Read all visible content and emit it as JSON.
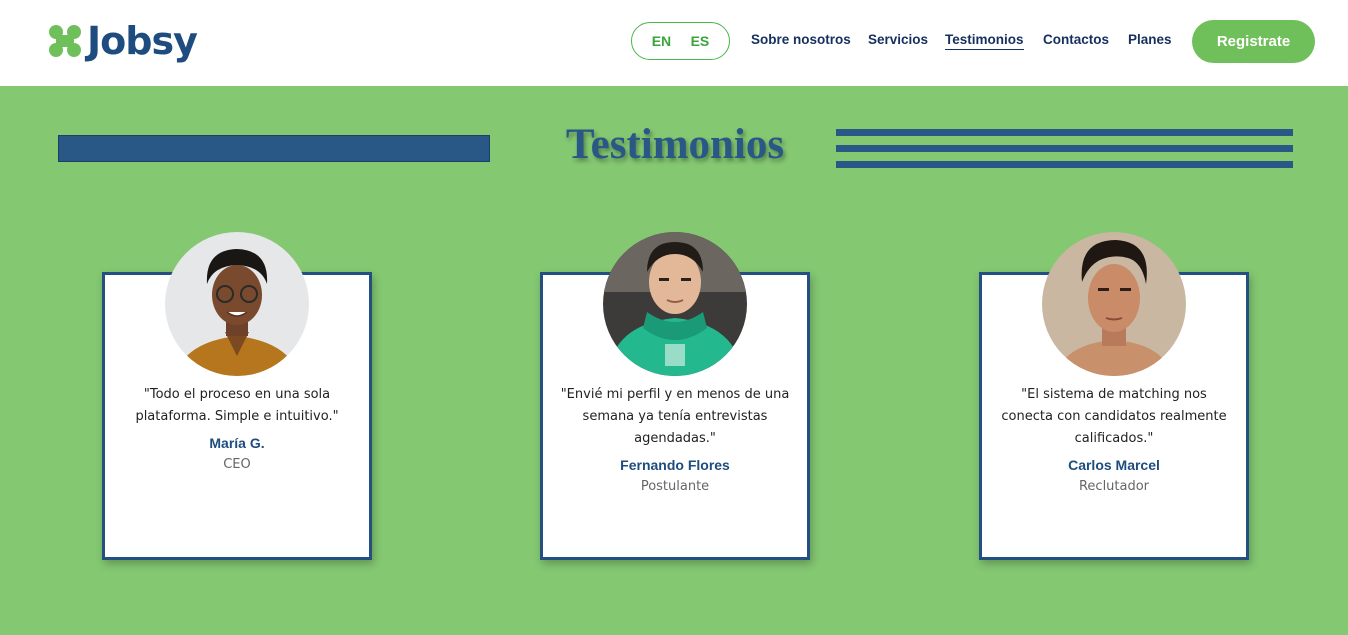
{
  "brand": {
    "name": "Jobsy",
    "accent": "#6fc05a",
    "primary": "#1e4c7e"
  },
  "lang": {
    "en": "EN",
    "es": "ES"
  },
  "nav": [
    {
      "label": "Sobre nosotros"
    },
    {
      "label": "Servicios"
    },
    {
      "label": "Testimonios",
      "active": true
    },
    {
      "label": "Contactos"
    },
    {
      "label": "Planes"
    }
  ],
  "cta": {
    "label": "Registrate"
  },
  "section": {
    "title": "Testimonios",
    "background": "#84c872"
  },
  "testimonials": [
    {
      "quote": "\"Todo el proceso en una sola plataforma. Simple e intuitivo.\"",
      "name": "María G.",
      "role": "CEO"
    },
    {
      "quote": "\"Envié mi perfil y en menos de una semana ya tenía entrevistas agendadas.\"",
      "name": "Fernando Flores",
      "role": "Postulante"
    },
    {
      "quote": "\"El sistema de matching nos conecta con candidatos realmente calificados.\"",
      "name": "Carlos Marcel",
      "role": "Reclutador"
    }
  ]
}
